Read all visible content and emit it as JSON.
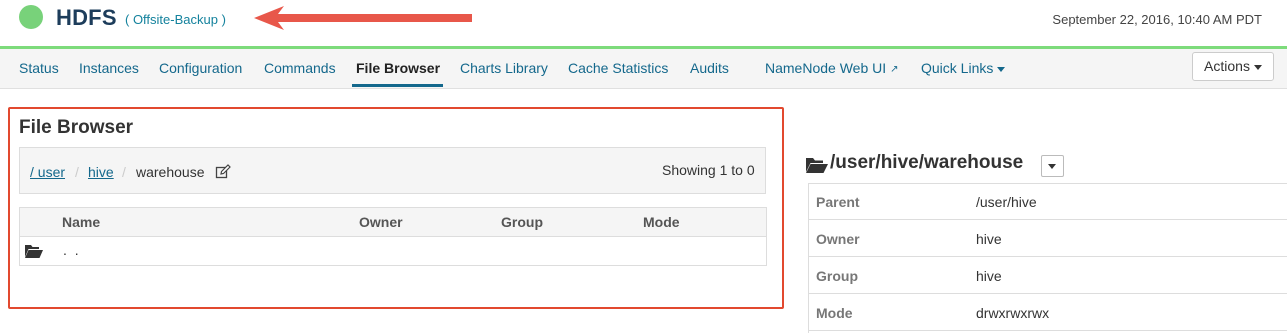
{
  "header": {
    "title": "HDFS",
    "cluster": "( Offsite-Backup )",
    "timestamp": "September 22, 2016, 10:40 AM PDT",
    "status_color": "#78d27a",
    "arrow_color": "#e8574a"
  },
  "nav": {
    "tabs": [
      {
        "label": "Status"
      },
      {
        "label": "Instances"
      },
      {
        "label": "Configuration"
      },
      {
        "label": "Commands"
      },
      {
        "label": "File Browser",
        "active": true
      },
      {
        "label": "Charts Library"
      },
      {
        "label": "Cache Statistics"
      },
      {
        "label": "Audits"
      },
      {
        "label": "NameNode Web UI",
        "icon": "external-link-icon"
      },
      {
        "label": "Quick Links",
        "icon": "caret-down-icon"
      }
    ],
    "actions_label": "Actions"
  },
  "file_browser": {
    "title": "File Browser",
    "breadcrumb": [
      {
        "label": "/ user",
        "link": true
      },
      {
        "label": "/",
        "separator": true
      },
      {
        "label": "hive",
        "link": true
      },
      {
        "label": "/",
        "separator": true
      },
      {
        "label": "warehouse",
        "link": false
      }
    ],
    "edit_icon": "edit-icon",
    "showing": "Showing 1 to 0",
    "columns": [
      "Name",
      "Owner",
      "Group",
      "Mode"
    ],
    "rows": [
      {
        "icon": "folder-open-icon",
        "name": ". ."
      }
    ],
    "highlight_color": "#e2492f"
  },
  "details": {
    "path": "/user/hive/warehouse",
    "rows": [
      {
        "label": "Parent",
        "value": "/user/hive"
      },
      {
        "label": "Owner",
        "value": "hive"
      },
      {
        "label": "Group",
        "value": "hive"
      },
      {
        "label": "Mode",
        "value": "drwxrwxrwx"
      }
    ]
  }
}
